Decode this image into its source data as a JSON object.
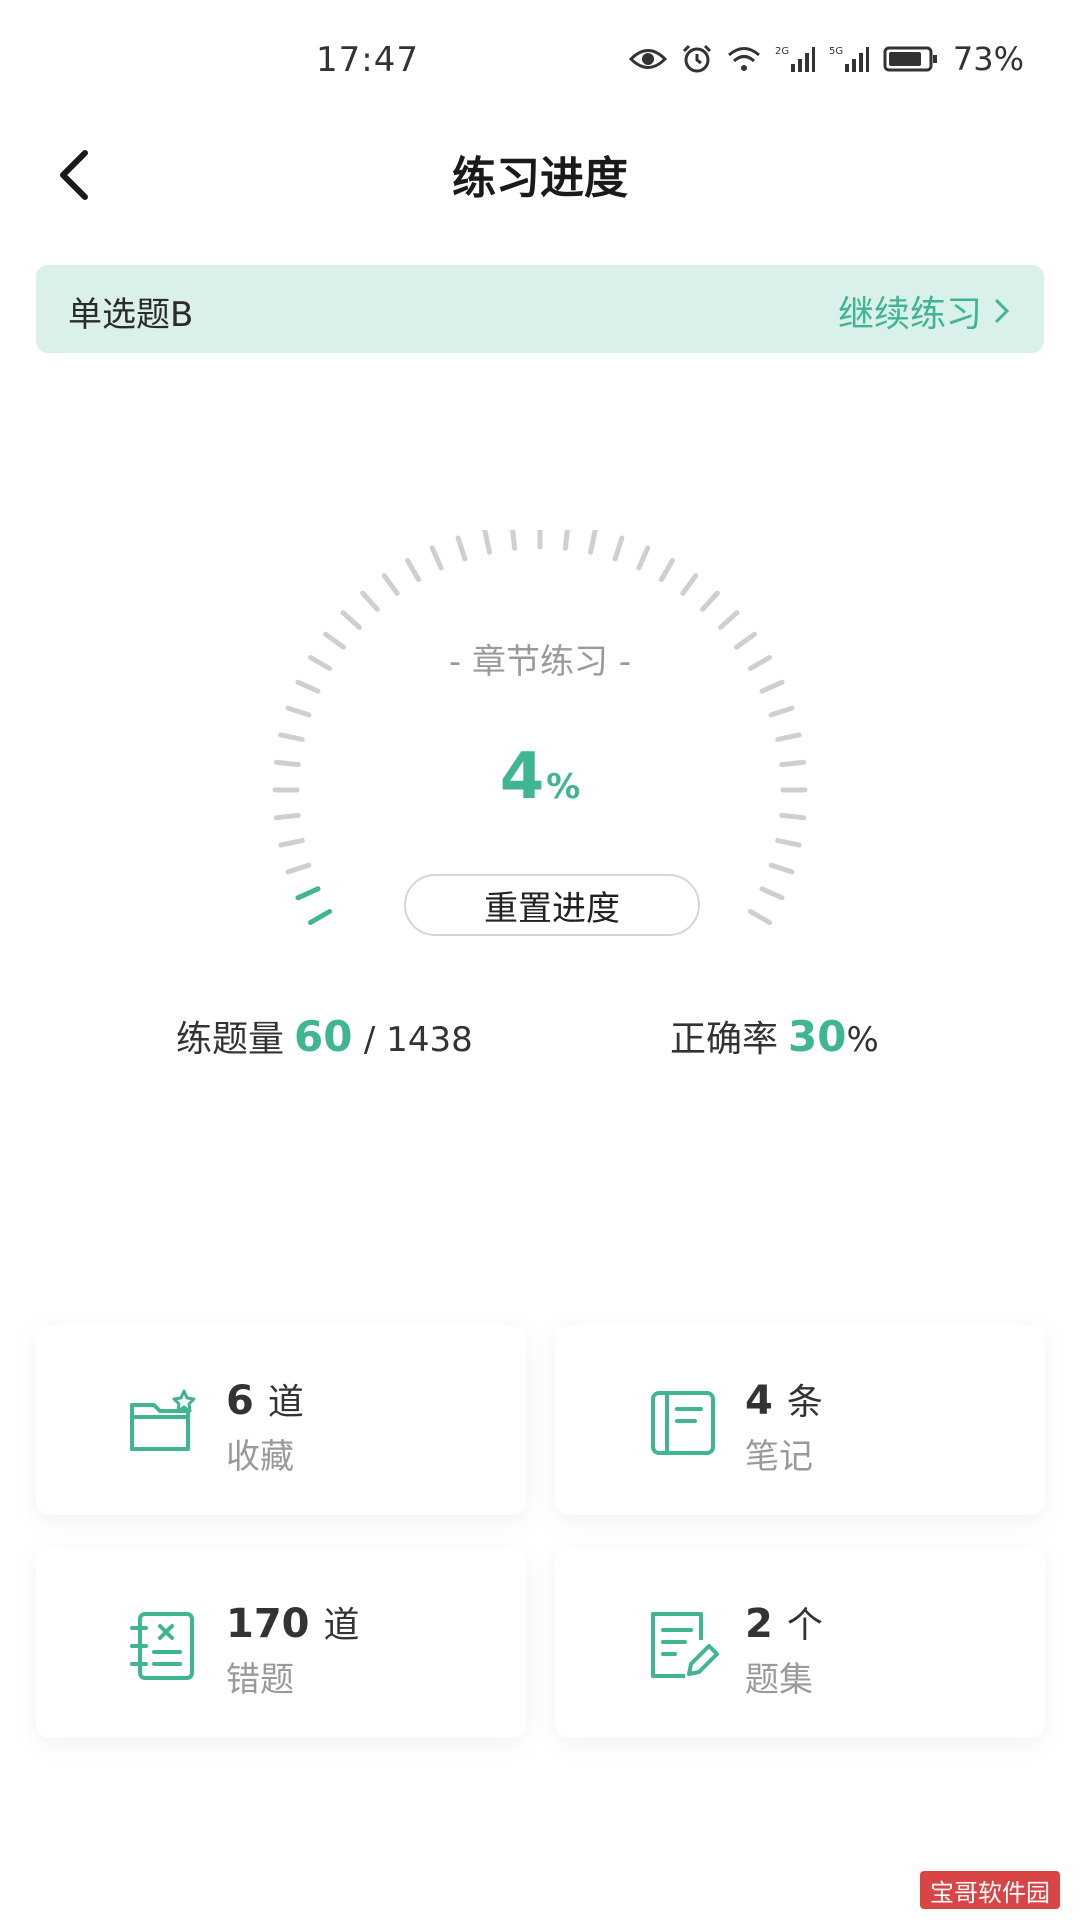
{
  "status_bar": {
    "time": "17:47",
    "battery": "73%",
    "icons": [
      "eye-icon",
      "alarm-icon",
      "wifi-icon",
      "signal-2g-icon",
      "signal-5g-icon",
      "battery-icon"
    ]
  },
  "header": {
    "title": "练习进度",
    "back_icon": "back-arrow-icon"
  },
  "banner": {
    "subject": "单选题B",
    "continue_label": "继续练习",
    "background": "#d9f1ea",
    "accent": "#3fb592"
  },
  "gauge": {
    "caption": "- 章节练习 -",
    "percent_value": "4",
    "percent_unit": "%",
    "progress_fraction": 0.04,
    "reset_label": "重置进度"
  },
  "stats": {
    "done_label": "练题量",
    "done_value": "60",
    "total": "/ 1438",
    "accuracy_label": "正确率",
    "accuracy_value": "30",
    "accuracy_unit": "%"
  },
  "cards": [
    {
      "count": "6",
      "unit": "道",
      "label": "收藏",
      "icon": "folder-star-icon"
    },
    {
      "count": "4",
      "unit": "条",
      "label": "笔记",
      "icon": "notebook-icon"
    },
    {
      "count": "170",
      "unit": "道",
      "label": "错题",
      "icon": "wrong-notebook-icon"
    },
    {
      "count": "2",
      "unit": "个",
      "label": "题集",
      "icon": "edit-list-icon"
    }
  ],
  "watermark": "宝哥软件园",
  "colors": {
    "accent": "#3fb592",
    "muted": "#9a9a9a",
    "tick_inactive": "#cfcfcf"
  }
}
